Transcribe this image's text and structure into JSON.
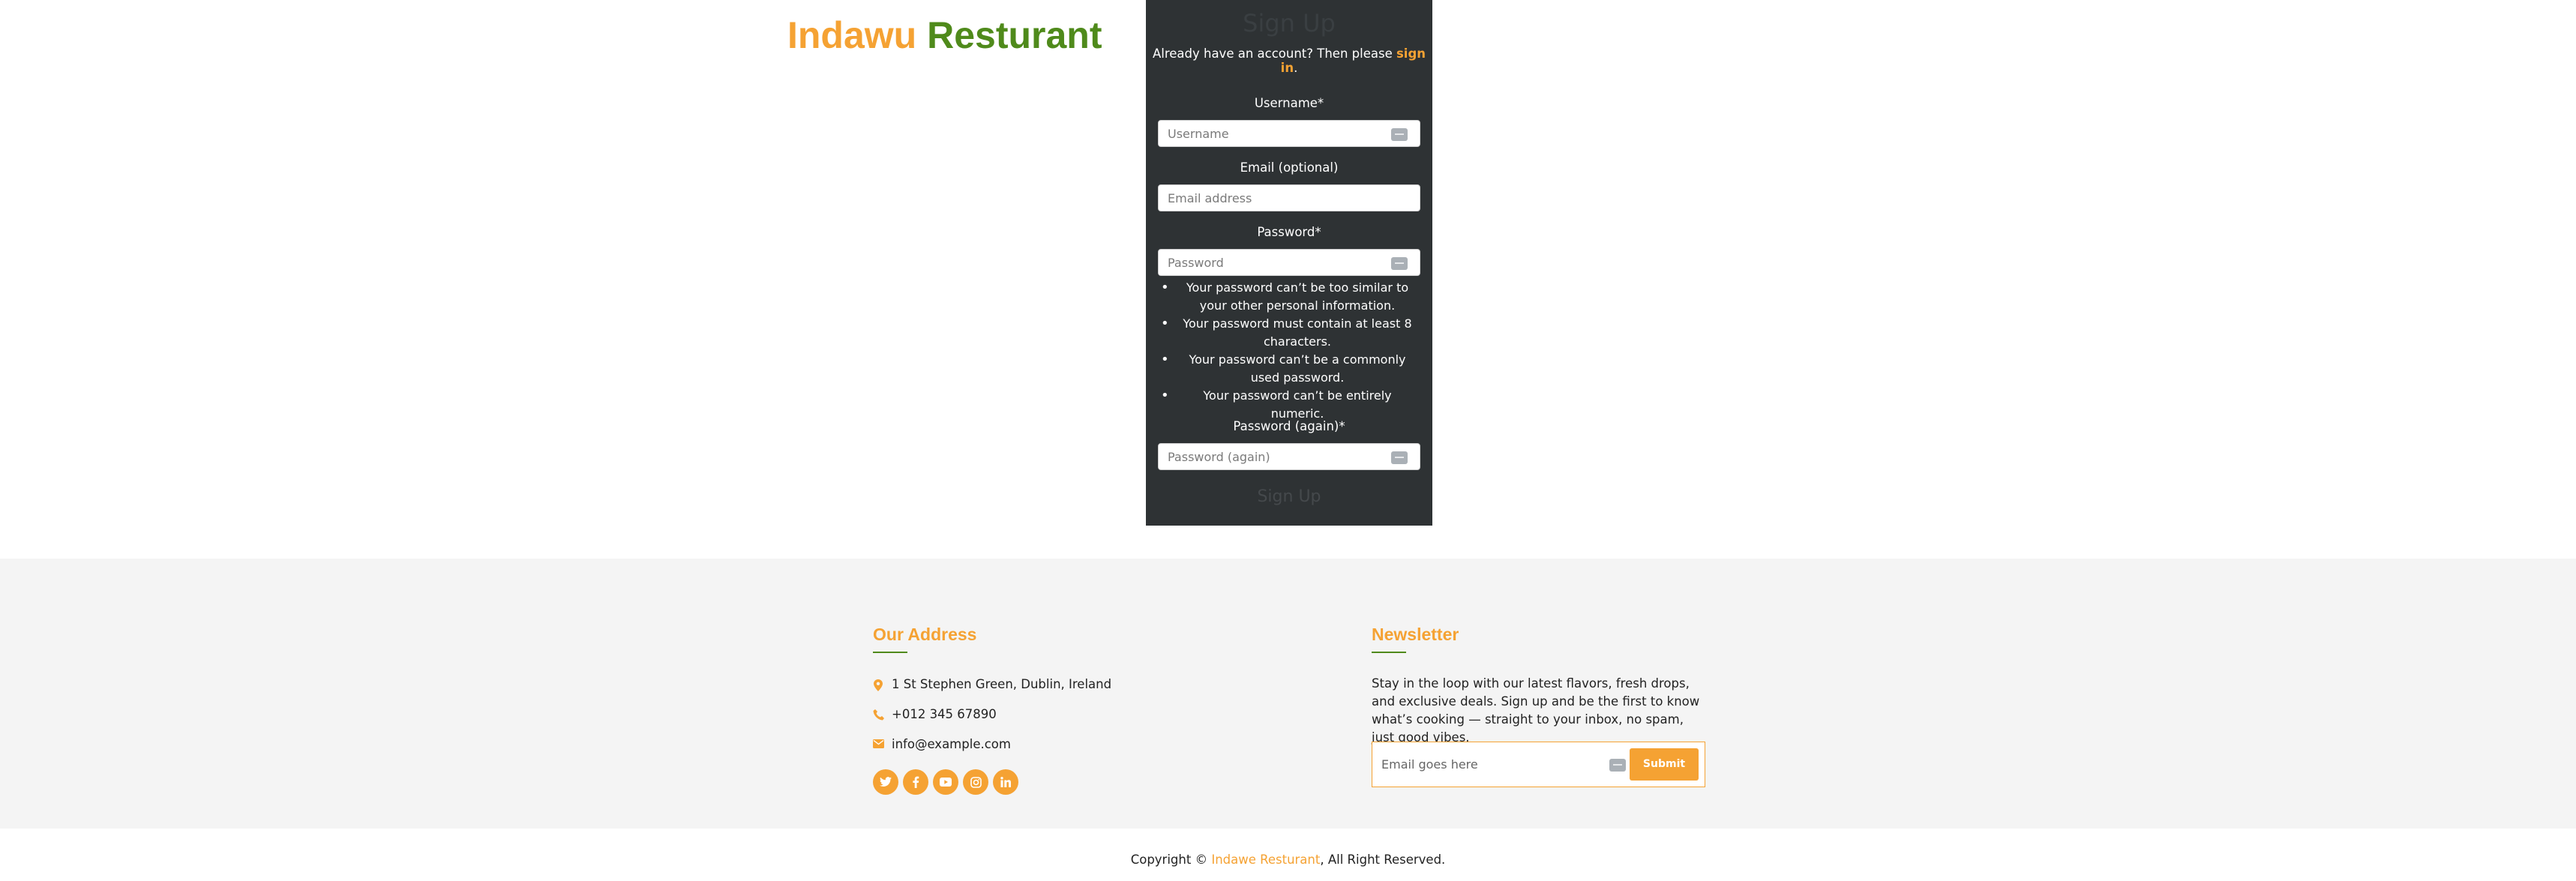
{
  "brand": {
    "part1": "Indawu",
    "part2": "Resturant"
  },
  "signup": {
    "title": "Sign Up",
    "already_text": "Already have an account? Then please",
    "signin_link": "sign in",
    "already_suffix": ".",
    "fields": [
      {
        "label": "Username*",
        "placeholder": "Username"
      },
      {
        "label": "Email (optional)",
        "placeholder": "Email address"
      },
      {
        "label": "Password*",
        "placeholder": "Password"
      },
      {
        "label": "Password (again)*",
        "placeholder": "Password (again)"
      }
    ],
    "password_help": [
      "Your password can’t be too similar to your other personal information.",
      "Your password must contain at least 8 characters.",
      "Your password can’t be a commonly used password.",
      "Your password can’t be entirely numeric."
    ],
    "submit_label": "Sign Up"
  },
  "footer": {
    "address": {
      "title": "Our Address",
      "street": "1 St Stephen Green, Dublin, Ireland",
      "phone": "+012 345 67890",
      "email": "info@example.com",
      "social": [
        "twitter-icon",
        "facebook-icon",
        "youtube-icon",
        "instagram-icon",
        "linkedin-icon"
      ]
    },
    "newsletter": {
      "title": "Newsletter",
      "text": "Stay in the loop with our latest flavors, fresh drops, and exclusive deals. Sign up and be the first to know what’s cooking — straight to your inbox, no spam, just good vibes.",
      "placeholder": "Email goes here",
      "submit_label": "Submit"
    },
    "copyright": {
      "prefix": "Copyright ©",
      "brand": "Indawe Resturant",
      "suffix": ", All Right Reserved."
    }
  },
  "colors": {
    "accent": "#f5a233",
    "green": "#4f8a1b",
    "panel": "#2e3234"
  }
}
